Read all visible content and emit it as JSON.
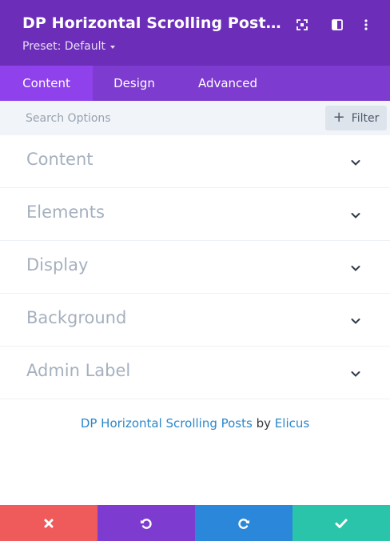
{
  "header": {
    "title": "DP Horizontal Scrolling Posts Set...",
    "preset_label": "Preset: Default",
    "bg_color": "#6c2eb9",
    "icons": [
      "expand-icon",
      "sidebar-toggle-icon",
      "more-options-icon"
    ]
  },
  "tabs": [
    {
      "label": "Content",
      "active": true
    },
    {
      "label": "Design",
      "active": false
    },
    {
      "label": "Advanced",
      "active": false
    }
  ],
  "search": {
    "placeholder": "Search Options",
    "value": "",
    "filter_label": "Filter"
  },
  "sections": [
    {
      "label": "Content"
    },
    {
      "label": "Elements"
    },
    {
      "label": "Display"
    },
    {
      "label": "Background"
    },
    {
      "label": "Admin Label"
    }
  ],
  "credit": {
    "plugin": "DP Horizontal Scrolling Posts",
    "by": "by",
    "author": "Elicus"
  },
  "footer": {
    "buttons": [
      {
        "name": "discard",
        "icon": "close-icon",
        "color": "#ef5a5a"
      },
      {
        "name": "undo",
        "icon": "undo-icon",
        "color": "#7e3bd0"
      },
      {
        "name": "redo",
        "icon": "redo-icon",
        "color": "#2b87da"
      },
      {
        "name": "save",
        "icon": "check-icon",
        "color": "#29c4a9"
      }
    ]
  }
}
